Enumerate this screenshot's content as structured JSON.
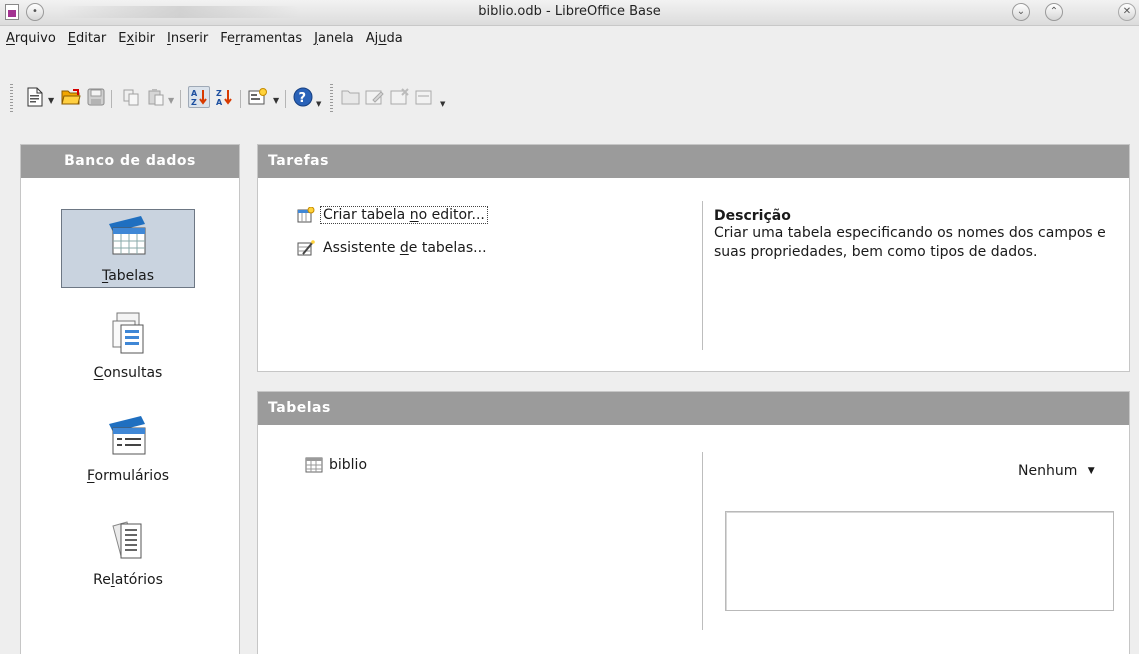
{
  "window": {
    "title": "biblio.odb - LibreOffice Base"
  },
  "menu": [
    {
      "pre": "",
      "key": "A",
      "post": "rquivo"
    },
    {
      "pre": "",
      "key": "E",
      "post": "ditar"
    },
    {
      "pre": "E",
      "key": "x",
      "post": "ibir"
    },
    {
      "pre": "",
      "key": "I",
      "post": "nserir"
    },
    {
      "pre": "Fe",
      "key": "r",
      "post": "ramentas"
    },
    {
      "pre": "",
      "key": "J",
      "post": "anela"
    },
    {
      "pre": "Aj",
      "key": "u",
      "post": "da"
    }
  ],
  "toolbar": {
    "icons": [
      "new-document-icon",
      "open-folder-icon",
      "save-icon",
      "copy-icon",
      "paste-icon",
      "sort-ascending-icon",
      "sort-descending-icon",
      "form-design-icon",
      "help-icon",
      "open-db-object-icon",
      "edit-icon",
      "delete-icon",
      "rename-icon"
    ]
  },
  "sidebar": {
    "header": "Banco de dados",
    "items": [
      {
        "pre": "",
        "key": "T",
        "post": "abelas",
        "selected": true
      },
      {
        "pre": "",
        "key": "C",
        "post": "onsultas",
        "selected": false
      },
      {
        "pre": "",
        "key": "F",
        "post": "ormulários",
        "selected": false
      },
      {
        "pre": "Re",
        "key": "l",
        "post": "atórios",
        "selected": false
      }
    ]
  },
  "tasks": {
    "header": "Tarefas",
    "items": [
      {
        "pre": "Criar tabela ",
        "key": "n",
        "post": "o editor...",
        "selected": true
      },
      {
        "pre": "Assistente ",
        "key": "d",
        "post": "e tabelas...",
        "selected": false
      }
    ],
    "description_title": "Descrição",
    "description_text": "Criar uma tabela especificando os nomes dos campos e suas propriedades, bem como tipos de dados."
  },
  "objects": {
    "header": "Tabelas",
    "items": [
      "biblio"
    ],
    "preview_mode": "Nenhum"
  }
}
